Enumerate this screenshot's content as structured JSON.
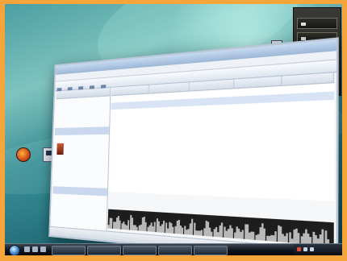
{
  "desktop": {
    "icons": [
      "firefox-icon",
      "computer-icon",
      "document-icon"
    ]
  },
  "gadgets": {
    "title": "",
    "items": [
      "",
      "",
      "",
      "",
      ""
    ]
  },
  "explorer": {
    "title": "",
    "menu": [],
    "tree_items": [],
    "columns": [],
    "rows": [],
    "status": ""
  },
  "taskbar": {
    "clock": ""
  },
  "colors": {
    "frame": "#f6a53a",
    "desktop": "#3d8f95",
    "taskbar": "#0d1218"
  }
}
